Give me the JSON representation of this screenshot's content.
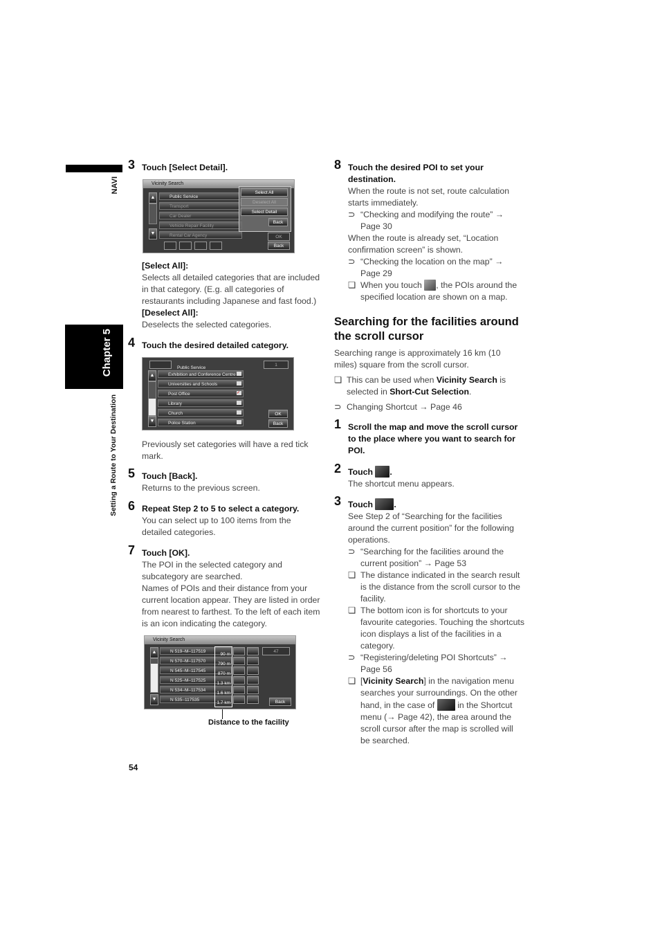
{
  "sidebar": {
    "navi_label": "NAVI",
    "chapter_label": "Chapter 5",
    "section_label": "Setting a Route to Your Destination"
  },
  "page_number": "54",
  "left_column": {
    "step3": {
      "num": "3",
      "title": "Touch [Select Detail].",
      "screen": {
        "title": "Vicinity Search",
        "categories": [
          "Public Service",
          "Transport",
          "Car Dealer",
          "Vehicle Repair Facility",
          "Rental Car Agency"
        ],
        "popup_buttons": [
          "Select All",
          "Deselect All",
          "Select Detail",
          "Back"
        ],
        "ok_label": "OK",
        "back_label": "Back"
      },
      "select_all_label": "[Select All]:",
      "select_all_text": "Selects all detailed categories that are included in that category. (E.g. all categories of restaurants including Japanese and fast food.)",
      "deselect_all_label": "[Deselect All]:",
      "deselect_all_text": "Deselects the selected categories."
    },
    "step4": {
      "num": "4",
      "title": "Touch the desired detailed category.",
      "screen": {
        "header": "Public Service",
        "count": "1",
        "items": [
          "Exhibition and Conference Centre",
          "Universities and Schools",
          "Post Office",
          "Library",
          "Church",
          "Police Station"
        ],
        "checked_index": 2,
        "ok_label": "OK",
        "back_label": "Back"
      },
      "note": "Previously set categories will have a red tick mark."
    },
    "step5": {
      "num": "5",
      "title": "Touch [Back].",
      "text": "Returns to the previous screen."
    },
    "step6": {
      "num": "6",
      "title": "Repeat Step 2 to 5 to select a category.",
      "text": "You can select up to 100 items from the detailed categories."
    },
    "step7": {
      "num": "7",
      "title": "Touch [OK].",
      "text1": "The POI in the selected category and subcategory are searched.",
      "text2": "Names of POIs and their distance from your current location appear. They are listed in order from nearest to farthest. To the left of each item is an icon indicating the category.",
      "screen": {
        "title": "Vicinity Search",
        "count": "47",
        "results": [
          {
            "name": "N 519–M–117519",
            "distance": "90 m"
          },
          {
            "name": "N 570–M–117570",
            "distance": "790 m"
          },
          {
            "name": "N 545–M–117545",
            "distance": "870 m"
          },
          {
            "name": "N 525–M–117525",
            "distance": "1.3 km"
          },
          {
            "name": "N 534–M–117534",
            "distance": "1.6 km"
          },
          {
            "name": "N 535–117535",
            "distance": "1.7 km"
          }
        ],
        "back_label": "Back"
      },
      "callout": "Distance to the facility"
    }
  },
  "right_column": {
    "step8": {
      "num": "8",
      "title": "Touch the desired POI to set your destination.",
      "text1": "When the route is not set, route calculation starts immediately.",
      "ref1": "“Checking and modifying the route” → Page 30",
      "text2": "When the route is already set, “Location confirmation screen” is shown.",
      "ref2": "“Checking the location on the map” → Page 29",
      "note_pre": "When you touch",
      "note_post": ", the POIs around the specified location are shown on a map."
    },
    "section": {
      "heading": "Searching for the facilities around the scroll cursor",
      "intro": "Searching range is approximately 16 km (10 miles) square from the scroll cursor.",
      "note_pre": "This can be used when ",
      "note_b1": "Vicinity Search",
      "note_mid": " is selected in ",
      "note_b2": "Short-Cut Selection",
      "note_end": ".",
      "ref": "Changing Shortcut → Page 46"
    },
    "step1": {
      "num": "1",
      "title": "Scroll the map and move the scroll cursor to the place where you want to search for POI."
    },
    "step2": {
      "num": "2",
      "title_pre": "Touch",
      "title_post": ".",
      "text": "The shortcut menu appears."
    },
    "step3": {
      "num": "3",
      "title_pre": "Touch",
      "title_post": ".",
      "text": "See Step 2 of “Searching for the facilities around the current position” for the following operations.",
      "ref1": "“Searching for the facilities around the current position” → Page 53",
      "note1": "The distance indicated in the search result is the distance from the scroll cursor to the facility.",
      "note2": "The bottom icon is for shortcuts to your favourite categories. Touching the shortcuts icon displays a list of the facilities in a category.",
      "ref2": "“Registering/deleting POI Shortcuts” → Page 56",
      "note3_open": "[",
      "note3_b": "Vicinity Search",
      "note3_a": "] in the navigation menu searches your surroundings. On the other hand, in the case of",
      "note3_b2": "in the Shortcut menu (→ Page 42), the area around the scroll cursor after the map is scrolled will be searched."
    }
  },
  "markers": {
    "ref": "⊃",
    "note": "❏"
  }
}
